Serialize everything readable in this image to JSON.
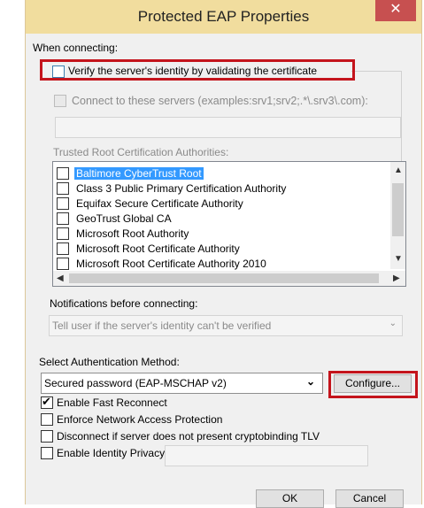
{
  "window": {
    "title": "Protected EAP Properties",
    "close_glyph": "✕"
  },
  "connecting": {
    "heading": "When connecting:",
    "verify_label": "Verify the server's identity by validating the certificate",
    "verify_checked": false,
    "connect_servers_label": "Connect to these servers (examples:srv1;srv2;.*\\.srv3\\.com):",
    "servers_value": "",
    "trusted_root_label": "Trusted Root Certification Authorities:",
    "cert_authorities": [
      {
        "name": "Baltimore CyberTrust Root",
        "selected": true
      },
      {
        "name": "Class 3 Public Primary Certification Authority",
        "selected": false
      },
      {
        "name": "Equifax Secure Certificate Authority",
        "selected": false
      },
      {
        "name": "GeoTrust Global CA",
        "selected": false
      },
      {
        "name": "Microsoft Root Authority",
        "selected": false
      },
      {
        "name": "Microsoft Root Certificate Authority",
        "selected": false
      },
      {
        "name": "Microsoft Root Certificate Authority 2010",
        "selected": false
      }
    ],
    "notifications_label": "Notifications before connecting:",
    "notifications_value": "Tell user if the server's identity can't be verified"
  },
  "auth": {
    "method_label": "Select Authentication Method:",
    "method_value": "Secured password (EAP-MSCHAP v2)",
    "configure_label": "Configure..."
  },
  "options": [
    {
      "label": "Enable Fast Reconnect",
      "checked": true
    },
    {
      "label": "Enforce Network Access Protection",
      "checked": false
    },
    {
      "label": "Disconnect if server does not present cryptobinding TLV",
      "checked": false
    },
    {
      "label": "Enable Identity Privacy",
      "checked": false
    }
  ],
  "identity_privacy_value": "",
  "buttons": {
    "ok": "OK",
    "cancel": "Cancel"
  },
  "icons": {
    "check": "✔",
    "scroll_up": "up-arrow-icon",
    "scroll_down": "down-arrow-icon",
    "scroll_left": "left-arrow-icon",
    "scroll_right": "right-arrow-icon",
    "dropdown": "chevron-down-icon"
  },
  "colors": {
    "titlebar": "#f1dd9e",
    "highlight": "#c4141c",
    "selection": "#3399ff",
    "close": "#c75050"
  }
}
